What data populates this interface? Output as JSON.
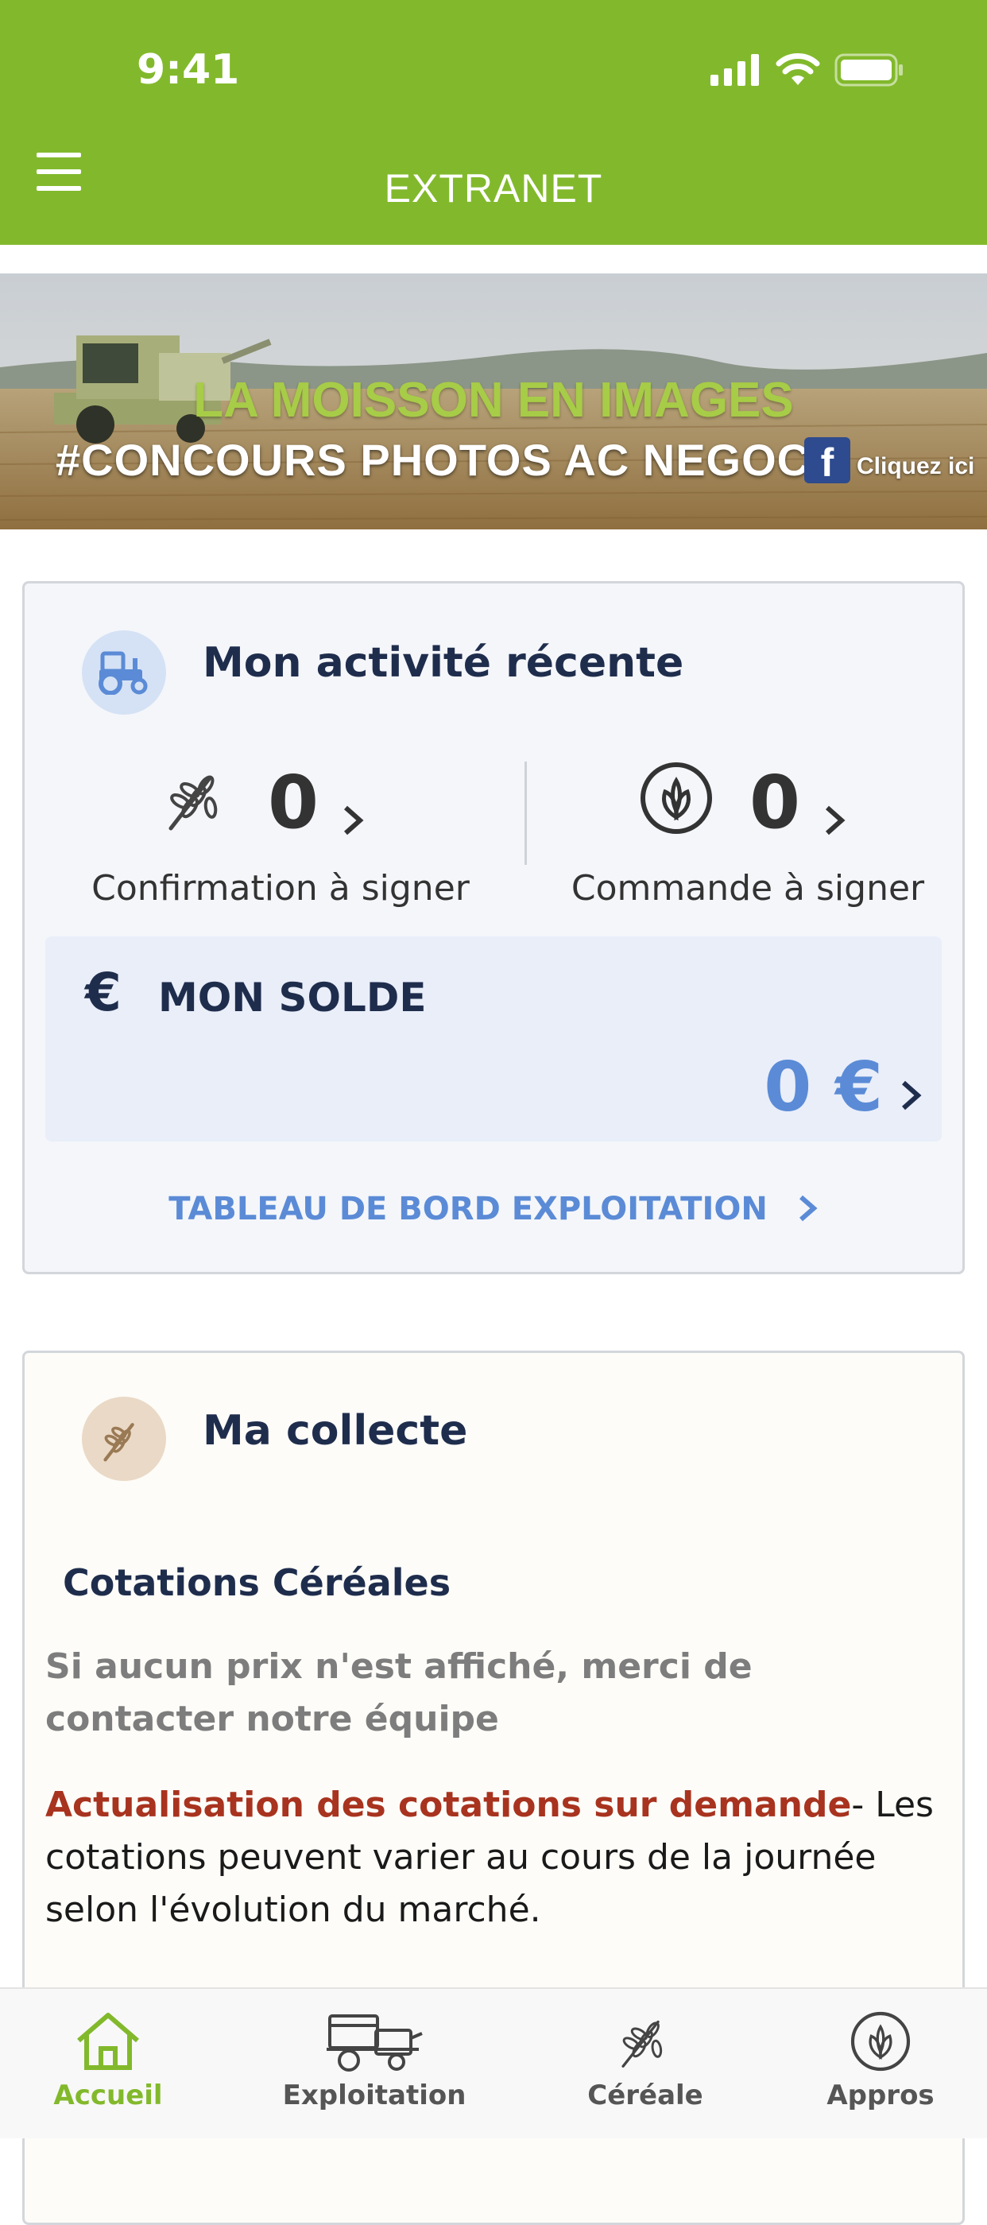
{
  "status_bar": {
    "time": "9:41"
  },
  "header": {
    "title": "EXTRANET"
  },
  "banner": {
    "title": "LA MOISSON EN IMAGES",
    "subtitle": "#CONCOURS PHOTOS AC NEGOCE",
    "cta": "Cliquez ici"
  },
  "activity": {
    "title": "Mon activité récente",
    "confirmation": {
      "count": "0",
      "label": "Confirmation à signer"
    },
    "commande": {
      "count": "0",
      "label": "Commande à signer"
    },
    "solde": {
      "title": "MON SOLDE",
      "value": "0 €"
    },
    "dashboard_link": "TABLEAU DE BORD EXPLOITATION"
  },
  "collecte": {
    "title": "Ma collecte",
    "cotations_title": "Cotations Céréales",
    "notice": "Si aucun prix n'est affiché, merci de contacter notre équipe",
    "highlight": "Actualisation des cotations sur demande",
    "text": "- Les cotations peuvent varier au cours de la journée selon l'évolution du marché."
  },
  "tabs": [
    {
      "label": "Accueil",
      "icon": "home-icon",
      "active": true
    },
    {
      "label": "Exploitation",
      "icon": "harvester-icon",
      "active": false
    },
    {
      "label": "Céréale",
      "icon": "wheat-icon",
      "active": false
    },
    {
      "label": "Appros",
      "icon": "sprout-icon",
      "active": false
    }
  ],
  "colors": {
    "brand_green": "#82b92c",
    "navy": "#1f2d4d",
    "link_blue": "#5b8bd6",
    "highlight_red": "#a8331f"
  }
}
